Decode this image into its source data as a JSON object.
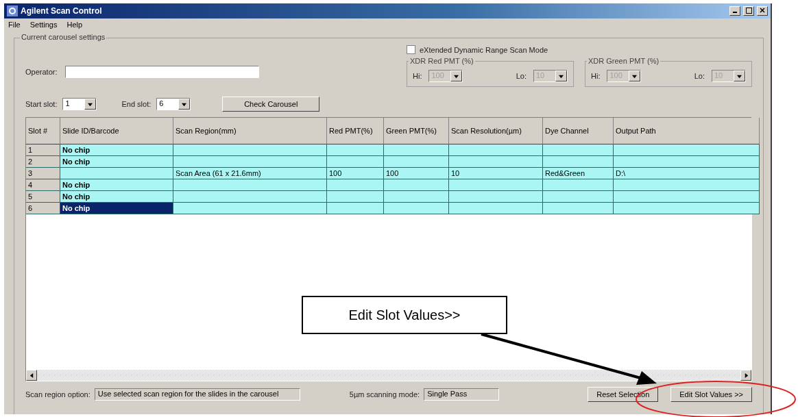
{
  "window": {
    "title": "Agilent Scan Control"
  },
  "menu": [
    "File",
    "Settings",
    "Help"
  ],
  "group": {
    "title": "Current carousel settings"
  },
  "operator": {
    "label": "Operator:"
  },
  "xdr": {
    "label": "eXtended Dynamic Range Scan Mode",
    "checked": false,
    "groups": [
      {
        "title": "XDR Red PMT (%)",
        "hi_label": "Hi:",
        "hi": "100",
        "lo_label": "Lo:",
        "lo": "10",
        "disabled": true
      },
      {
        "title": "XDR Green PMT (%)",
        "hi_label": "Hi:",
        "hi": "100",
        "lo_label": "Lo:",
        "lo": "10",
        "disabled": true
      }
    ]
  },
  "start_slot": {
    "label": "Start slot:",
    "value": "1"
  },
  "end_slot": {
    "label": "End slot:",
    "value": "6"
  },
  "check_button": "Check Carousel",
  "table": {
    "columns": [
      "Slot #",
      "Slide ID/Barcode",
      "Scan Region(mm)",
      "Red PMT(%)",
      "Green PMT(%)",
      "Scan Resolution(µm)",
      "Dye Channel",
      "Output Path"
    ],
    "rows": [
      {
        "cells": [
          "1",
          "No chip",
          "",
          "",
          "",
          "",
          "",
          ""
        ],
        "selected": false
      },
      {
        "cells": [
          "2",
          "No chip",
          "",
          "",
          "",
          "",
          "",
          ""
        ],
        "selected": false
      },
      {
        "cells": [
          "3",
          "",
          "Scan Area (61 x 21.6mm)",
          "100",
          "100",
          "10",
          "Red&Green",
          "D:\\"
        ],
        "selected": false
      },
      {
        "cells": [
          "4",
          "No chip",
          "",
          "",
          "",
          "",
          "",
          ""
        ],
        "selected": false
      },
      {
        "cells": [
          "5",
          "No chip",
          "",
          "",
          "",
          "",
          "",
          ""
        ],
        "selected": false
      },
      {
        "cells": [
          "6",
          "No chip",
          "",
          "",
          "",
          "",
          "",
          ""
        ],
        "selected": true
      }
    ]
  },
  "callout": "Edit Slot Values>>",
  "scan_region": {
    "label": "Scan region option:",
    "value": "Use selected scan region for the slides in the carousel"
  },
  "scan_mode": {
    "label": "5µm scanning mode:",
    "value": "Single Pass"
  },
  "buttons": [
    "Reset Selection",
    "Edit Slot Values >>"
  ]
}
